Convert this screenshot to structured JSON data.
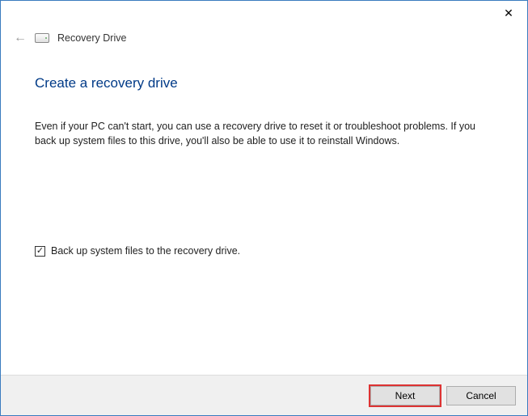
{
  "titlebar": {
    "close_tooltip": "Close"
  },
  "header": {
    "label": "Recovery Drive"
  },
  "main": {
    "heading": "Create a recovery drive",
    "body": "Even if your PC can't start, you can use a recovery drive to reset it or troubleshoot problems. If you back up system files to this drive, you'll also be able to use it to reinstall Windows."
  },
  "option": {
    "checked": true,
    "label": "Back up system files to the recovery drive."
  },
  "footer": {
    "next_label": "Next",
    "cancel_label": "Cancel"
  }
}
